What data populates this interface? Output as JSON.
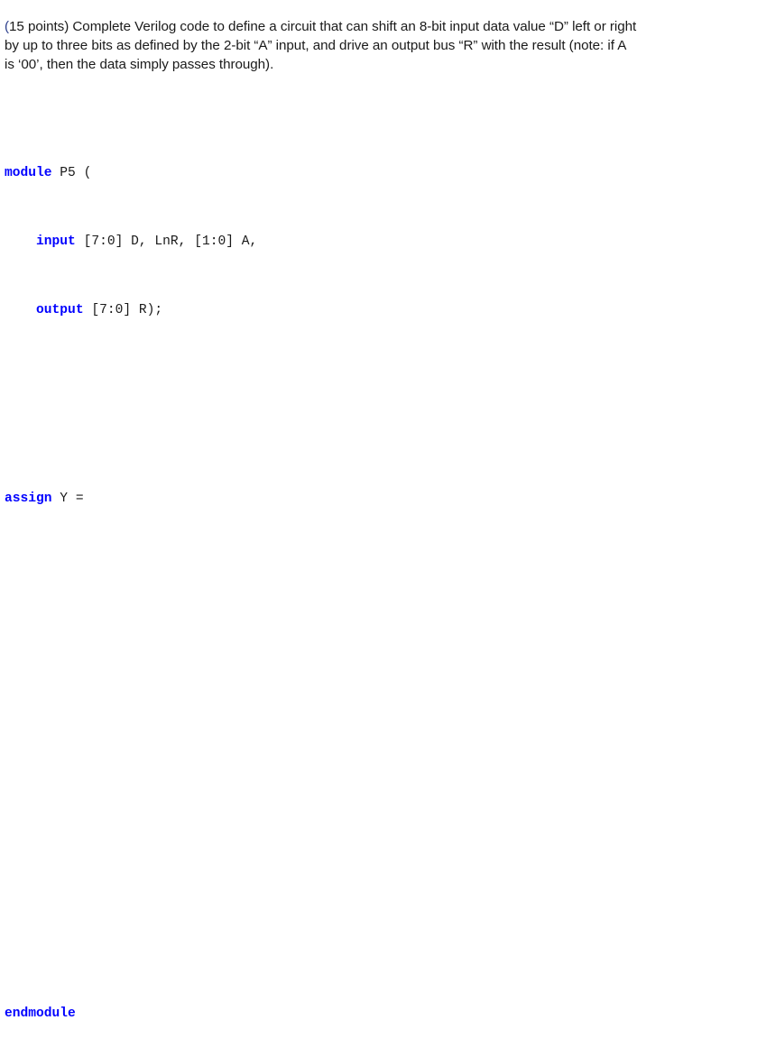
{
  "document": {
    "background_color": "#ffffff",
    "body_text_color": "#1a1a1a",
    "keyword_color": "#0000ff",
    "accent_paren_color": "#2c3f8c"
  },
  "question": {
    "points_label": "(15 points)",
    "lead_paren": "(",
    "line1": "15 points) Complete Verilog code to define a circuit that can shift an 8-bit input data value “D” left or right",
    "line2": "by up to three bits as defined by the 2-bit “A” input, and drive an output bus “R” with the result (note: if A",
    "line3": "is ‘00’, then the data simply passes through).",
    "full_text": "(15 points) Complete Verilog code to define a circuit that can shift an 8-bit input data value “D” left or right by up to three bits as defined by the 2-bit “A” input, and drive an output bus “R” with the result (note: if A is ‘00’, then the data simply passes through)."
  },
  "code": {
    "language": "verilog",
    "keywords": [
      "module",
      "input",
      "output",
      "assign",
      "endmodule"
    ],
    "lines": [
      {
        "kw": "module",
        "rest": " P5 ("
      },
      {
        "kw": "    input",
        "rest": " [7:0] D, LnR, [1:0] A,"
      },
      {
        "kw": "    output",
        "rest": " [7:0] R);"
      },
      {
        "kw": "",
        "rest": ""
      },
      {
        "kw": "",
        "rest": ""
      },
      {
        "kw": "assign",
        "rest": " Y ="
      }
    ],
    "line_module_kw": "module",
    "line_module_rest": " P5 (",
    "line_input_kw": "    input",
    "line_input_rest": " [7:0] D, LnR, [1:0] A,",
    "line_output_kw": "    output",
    "line_output_rest": " [7:0] R);",
    "line_assign_kw": "assign",
    "line_assign_rest": " Y =",
    "line_endmodule_kw": "endmodule"
  },
  "answer_area": {
    "label": "blank-answer-space"
  }
}
